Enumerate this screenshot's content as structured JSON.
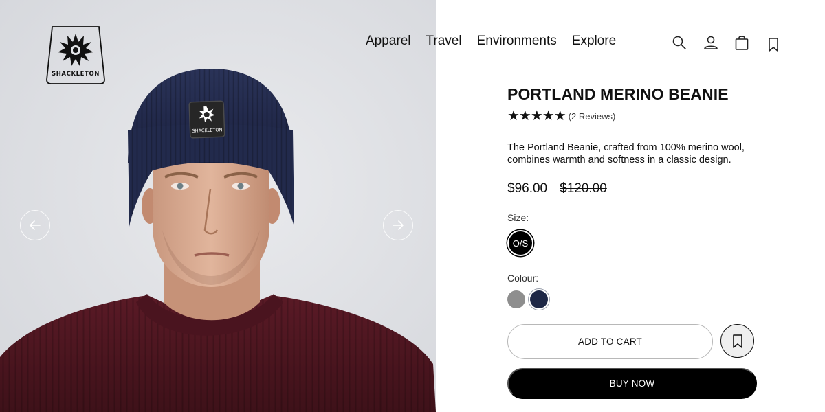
{
  "brand": {
    "name": "SHACKLETON"
  },
  "nav": {
    "items": [
      "Apparel",
      "Travel",
      "Environments",
      "Explore"
    ]
  },
  "header_icons": [
    "search-icon",
    "account-icon",
    "bag-icon",
    "bookmark-icon"
  ],
  "gallery": {
    "prev_icon": "arrow-left-icon",
    "next_icon": "arrow-right-icon",
    "badge_text": "SHACKLETON"
  },
  "product": {
    "title": "PORTLAND MERINO BEANIE",
    "stars": "★★★★★",
    "rating_out_of_5": 5,
    "reviews": "(2 Reviews)",
    "description": "The Portland Beanie, crafted from 100% merino wool, combines warmth and softness in a classic design.",
    "price": "$96.00",
    "original_price": "$120.00",
    "size_label": "Size:",
    "sizes": [
      "O/S"
    ],
    "colour_label": "Colour:",
    "colours": [
      {
        "name": "grey",
        "hex": "#8e8e8e"
      },
      {
        "name": "navy",
        "hex": "#1d2746"
      }
    ],
    "add_to_cart": "ADD TO CART",
    "buy_now": "BUY NOW"
  }
}
